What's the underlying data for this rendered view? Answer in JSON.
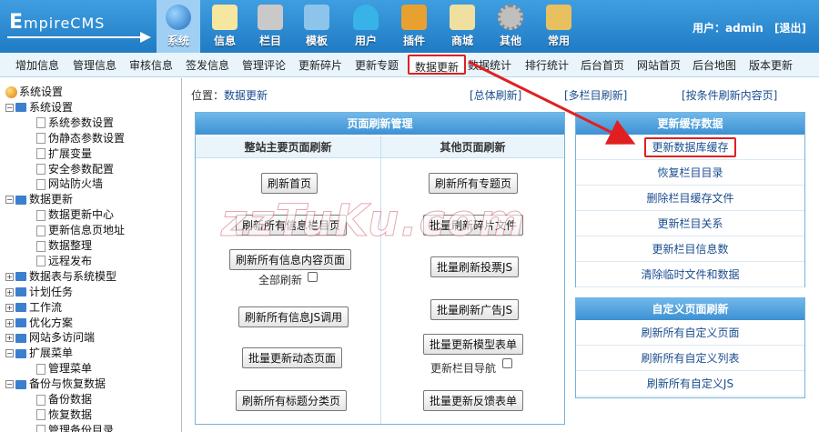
{
  "logo": {
    "text_big": "E",
    "text_rest": "mpireCMS"
  },
  "topnav": [
    {
      "label": "系统",
      "icon": "globe-icon",
      "color": "#2a7fcf",
      "active": true
    },
    {
      "label": "信息",
      "icon": "notepad-icon",
      "color": "#f5e7a0"
    },
    {
      "label": "栏目",
      "icon": "folder-icon",
      "color": "#c9c9c9"
    },
    {
      "label": "模板",
      "icon": "window-icon",
      "color": "#8cc4ec"
    },
    {
      "label": "用户",
      "icon": "user-icon",
      "color": "#37b3e8"
    },
    {
      "label": "插件",
      "icon": "tools-icon",
      "color": "#e8a030"
    },
    {
      "label": "商城",
      "icon": "card-icon",
      "color": "#f0e0a0"
    },
    {
      "label": "其他",
      "icon": "gear-icon",
      "color": "#bfbfbf"
    },
    {
      "label": "常用",
      "icon": "book-icon",
      "color": "#e8c060"
    }
  ],
  "user": {
    "label": "用户：admin",
    "logout": "[退出]"
  },
  "subnav": [
    "增加信息",
    "管理信息",
    "审核信息",
    "签发信息",
    "管理评论",
    "更新碎片",
    "更新专题",
    "数据更新",
    "数据统计",
    "排行统计",
    "后台首页",
    "网站首页",
    "后台地图",
    "版本更新"
  ],
  "tree": [
    {
      "label": "系统设置",
      "type": "root"
    },
    {
      "label": "系统设置",
      "type": "open"
    },
    {
      "label": "系统参数设置",
      "type": "leaf"
    },
    {
      "label": "伪静态参数设置",
      "type": "leaf"
    },
    {
      "label": "扩展变量",
      "type": "leaf"
    },
    {
      "label": "安全参数配置",
      "type": "leaf"
    },
    {
      "label": "网站防火墙",
      "type": "leaf"
    },
    {
      "label": "数据更新",
      "type": "open"
    },
    {
      "label": "数据更新中心",
      "type": "leaf"
    },
    {
      "label": "更新信息页地址",
      "type": "leaf"
    },
    {
      "label": "数据整理",
      "type": "leaf"
    },
    {
      "label": "远程发布",
      "type": "leaf"
    },
    {
      "label": "数据表与系统模型",
      "type": "closed"
    },
    {
      "label": "计划任务",
      "type": "closed"
    },
    {
      "label": "工作流",
      "type": "closed"
    },
    {
      "label": "优化方案",
      "type": "closed"
    },
    {
      "label": "网站多访问端",
      "type": "closed"
    },
    {
      "label": "扩展菜单",
      "type": "open"
    },
    {
      "label": "管理菜单",
      "type": "leaf"
    },
    {
      "label": "备份与恢复数据",
      "type": "open"
    },
    {
      "label": "备份数据",
      "type": "leaf"
    },
    {
      "label": "恢复数据",
      "type": "leaf"
    },
    {
      "label": "管理备份目录",
      "type": "leaf"
    }
  ],
  "main": {
    "crumb_label": "位置：",
    "crumb_link": "数据更新",
    "top_links": [
      "[总体刷新]",
      "[多栏目刷新]",
      "[按条件刷新内容页]"
    ],
    "refresh_panel": {
      "title": "页面刷新管理",
      "left_head": "整站主要页面刷新",
      "right_head": "其他页面刷新",
      "left_buttons": [
        "刷新首页",
        "刷新所有信息栏目页",
        "刷新所有信息内容页面",
        "刷新所有信息JS调用",
        "批量更新动态页面",
        "刷新所有标题分类页"
      ],
      "all_refresh": "全部刷新",
      "right_buttons": [
        "刷新所有专题页",
        "批量刷新碎片文件",
        "批量刷新投票JS",
        "批量刷新广告JS",
        "批量更新模型表单",
        "批量更新反馈表单"
      ],
      "nav_update": "更新栏目导航"
    },
    "cache_panel": {
      "title": "更新缓存数据",
      "items": [
        "更新数据库缓存",
        "恢复栏目目录",
        "删除栏目缓存文件",
        "更新栏目关系",
        "更新栏目信息数",
        "清除临时文件和数据"
      ]
    },
    "custom_panel": {
      "title": "自定义页面刷新",
      "items": [
        "刷新所有自定义页面",
        "刷新所有自定义列表",
        "刷新所有自定义JS"
      ]
    }
  },
  "watermark": "zzTuKu.com",
  "colors": {
    "top": "#2a86d0",
    "highlight": "#e02020",
    "link": "#1a4d8f"
  }
}
